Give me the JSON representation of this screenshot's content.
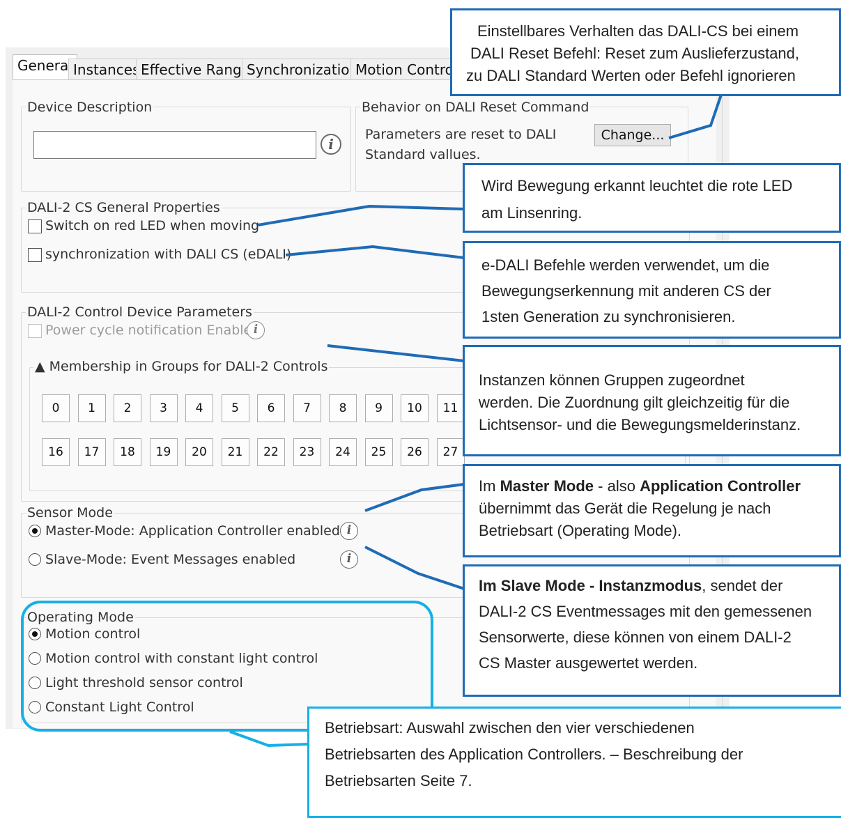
{
  "tabs": [
    "General",
    "Instances",
    "Effective Range",
    "Synchronization",
    "Motion Control"
  ],
  "device_description": {
    "title": "Device Description",
    "value": ""
  },
  "reset_behavior": {
    "title": "Behavior on DALI Reset Command",
    "line1": "Parameters are reset to DALI",
    "line2": "Standard vallues.",
    "button": "Change..."
  },
  "general_properties": {
    "title": "DALI-2 CS General Properties",
    "red_led": "Switch on red LED when moving",
    "red_led_checked": false,
    "sync": "synchronization with DALI CS (eDALI)",
    "sync_checked": false
  },
  "control_params": {
    "title": "DALI-2 Control Device Parameters",
    "power_cycle": "Power cycle notification Enable",
    "groups_title": "▲ Membership in Groups for DALI-2 Controls",
    "groups_row1": [
      "0",
      "1",
      "2",
      "3",
      "4",
      "5",
      "6",
      "7",
      "8",
      "9",
      "10",
      "11"
    ],
    "groups_row2": [
      "16",
      "17",
      "18",
      "19",
      "20",
      "21",
      "22",
      "23",
      "24",
      "25",
      "26",
      "27"
    ]
  },
  "sensor_mode": {
    "title": "Sensor Mode",
    "master": "Master-Mode: Application Controller enabled",
    "slave": "Slave-Mode: Event Messages enabled",
    "selected": "master"
  },
  "operating_mode": {
    "title": "Operating Mode",
    "options": [
      "Motion control",
      "Motion control with constant light control",
      "Light threshold sensor control",
      "Constant Light Control"
    ],
    "selected_index": 0
  },
  "callouts": {
    "reset": [
      "Einstellbares Verhalten das DALI-CS bei einem",
      "DALI Reset Befehl: Reset zum Auslieferzustand,",
      "zu DALI Standard Werten oder Befehl ignorieren"
    ],
    "led": [
      "Wird Bewegung erkannt leuchtet die rote LED",
      "am Linsenring."
    ],
    "edali": [
      "e-DALI Befehle werden verwendet, um die",
      "Bewegungserkennung mit anderen CS der",
      "1sten Generation zu synchronisieren."
    ],
    "groups": [
      "Instanzen können Gruppen zugeordnet",
      "werden. Die Zuordnung gilt gleichzeitig für die",
      "Lichtsensor- und die Bewegungsmelderinstanz."
    ],
    "master": {
      "l1_pre": "Im ",
      "l1_b1": "Master Mode",
      "l1_mid": " - also ",
      "l1_b2": "Application Controller",
      "l2": "übernimmt das Gerät die Regelung je nach",
      "l3": "Betriebsart (Operating Mode)."
    },
    "slave": {
      "l1_b": "Im Slave Mode - Instanzmodus",
      "l1_rest": ", sendet der",
      "l2": "DALI-2 CS Eventmessages mit den gemessenen",
      "l3": "Sensorwerte, diese können von einem DALI-2",
      "l4": "CS Master ausgewertet werden."
    },
    "operating": [
      "Betriebsart:  Auswahl zwischen den vier verschiedenen",
      "Betriebsarten des Application Controllers. – Beschreibung der",
      "Betriebsarten Seite 7."
    ]
  },
  "colors": {
    "callout_border": "#1f6bb5",
    "highlight_border": "#15b0e6"
  }
}
